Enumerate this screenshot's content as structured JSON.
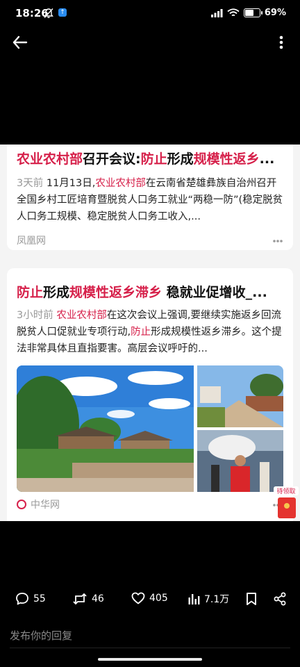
{
  "status_bar": {
    "time": "18:26",
    "app_badge": "↑",
    "battery": "69%",
    "battery_level": 0.69
  },
  "card1": {
    "title": {
      "p1": "农业农村部",
      "p2": "召开会议:",
      "p3": "防止",
      "p4": "形成",
      "p5": "规模性返乡",
      "p6": "..."
    },
    "time": "3天前",
    "body": {
      "p1": " 11月13日,",
      "p2": "农业农村部",
      "p3": "在云南省楚雄彝族自治州召开全国乡村工匠培育暨脱贫人口务工就业“两稳一防”(稳定脱贫人口务工规模、稳定脱贫人口务工收入,..."
    },
    "source": "凤凰网"
  },
  "card2": {
    "title": {
      "p1": "防止",
      "p2": "形成",
      "p3": "规模性返乡滞乡",
      "p4": " 稳就业促增收_..."
    },
    "time": "3小时前",
    "body": {
      "p1": " 农业农村部",
      "p2": "在这次会议上强调,要继续实施返乡回流脱贫人口促就业专项行动,",
      "p3": "防止",
      "p4": "形成规模性返乡滞乡。这个提法非常具体且直指要害。高层会议呼吁的..."
    },
    "source": "中华网"
  },
  "redpacket": {
    "label": "待领取"
  },
  "actions": {
    "comments": "55",
    "reposts": "46",
    "likes": "405",
    "views": "7.1万"
  },
  "reply": {
    "placeholder": "发布你的回复"
  },
  "colors": {
    "highlight": "#d6204a",
    "background": "#000000",
    "card": "#ffffff"
  }
}
